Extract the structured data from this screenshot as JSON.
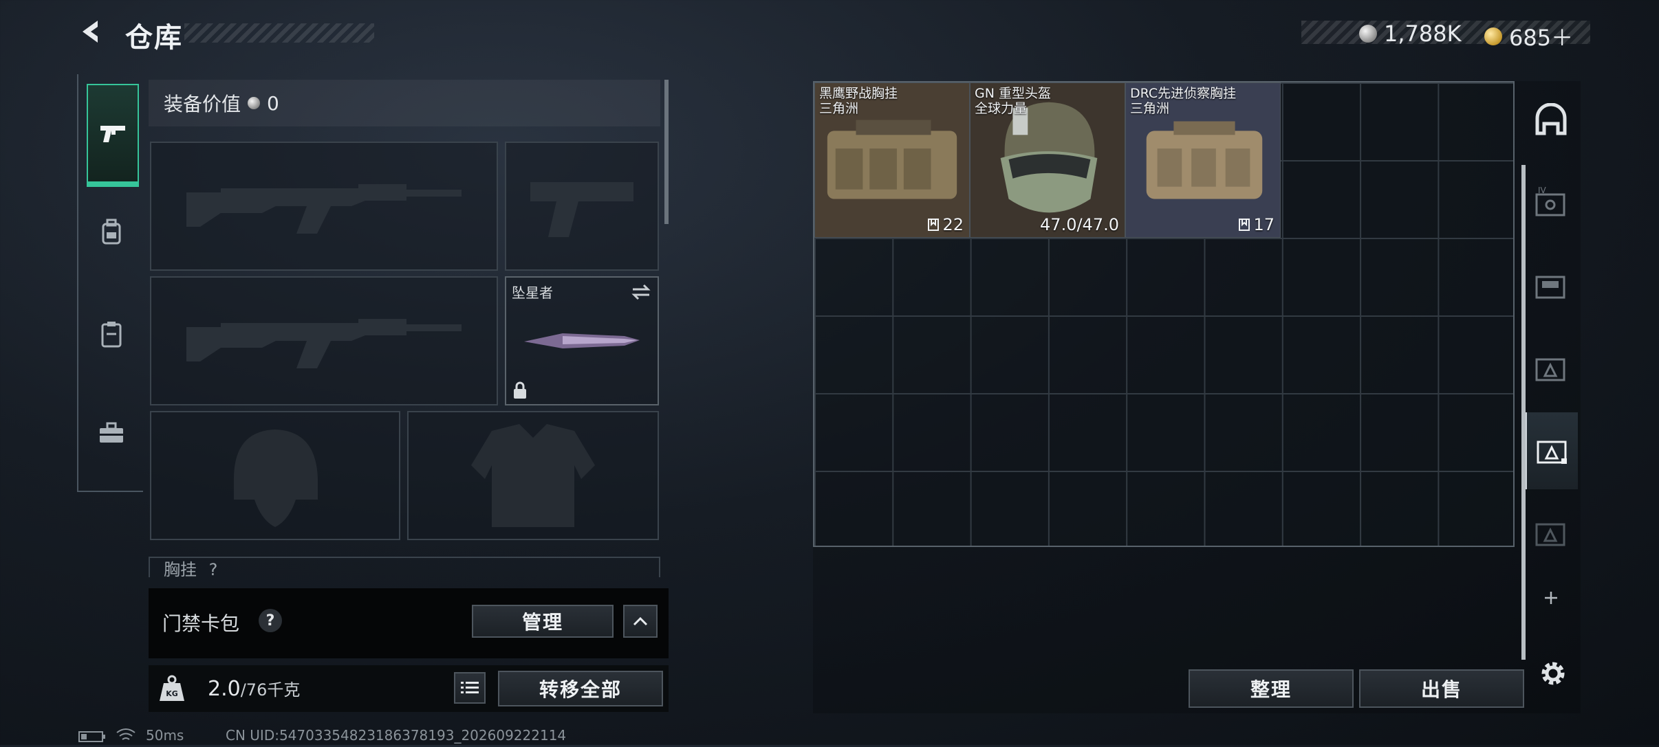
{
  "header": {
    "title": "仓库",
    "currencies": [
      {
        "icon": "silver-coin-icon",
        "value": "1,788K"
      },
      {
        "icon": "gold-coin-icon",
        "value": "685＋"
      }
    ]
  },
  "left_tabs": [
    {
      "name": "weapon-tab",
      "icon": "pistol-icon",
      "active": true
    },
    {
      "name": "gear-tab",
      "icon": "backpack-icon",
      "active": false
    },
    {
      "name": "rig-tab",
      "icon": "clipboard-icon",
      "active": false
    },
    {
      "name": "toolbox-tab",
      "icon": "toolbox-icon",
      "active": false
    }
  ],
  "loadout": {
    "value_label": "装备价值",
    "value": "0",
    "melee_slot_name": "坠星者",
    "chest_rig_label": "胸挂",
    "chest_rig_count": "?"
  },
  "access_card": {
    "label": "门禁卡包",
    "help": "?",
    "manage_label": "管理"
  },
  "weight": {
    "current": "2.0",
    "capacity": "/76千克",
    "transfer_all_label": "转移全部"
  },
  "storage_items": [
    {
      "name_line1": "黑鹰野战胸挂",
      "name_line2": "三角洲",
      "info": "22",
      "info_icon": "capacity-icon"
    },
    {
      "name_line1": "GN 重型头盔",
      "name_line2": "全球力量",
      "info": "47.0/47.0",
      "info_icon": ""
    },
    {
      "name_line1": "DRC先进侦察胸挂",
      "name_line2": "三角洲",
      "info": "17",
      "info_icon": "capacity-icon"
    }
  ],
  "bottom_buttons": {
    "sort_label": "整理",
    "sell_label": "出售"
  },
  "status_bar": {
    "ping": "50ms",
    "uid": "CN UID:54703354823186378193_202609222114"
  },
  "colors": {
    "accent_green": "#36c59a",
    "item_bg_brown": "#4a3f33",
    "item_bg_blue": "#3a3f52"
  }
}
